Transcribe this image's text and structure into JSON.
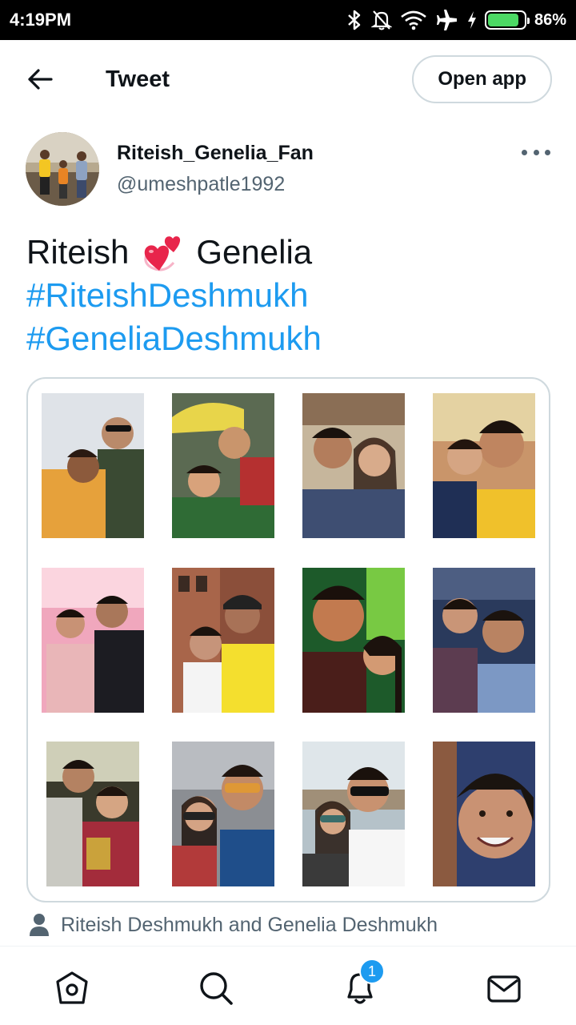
{
  "status_bar": {
    "time": "4:19PM",
    "battery_percent": "86%",
    "battery_level": 0.86,
    "icons": [
      "bluetooth-icon",
      "mute-notifications-icon",
      "wifi-icon",
      "airplane-mode-icon",
      "charging-icon",
      "battery-icon"
    ]
  },
  "header": {
    "title": "Tweet",
    "back_icon": "arrow-left-icon",
    "open_app_label": "Open app"
  },
  "tweet": {
    "author_name": "Riteish_Genelia_Fan",
    "author_handle": "@umeshpatle1992",
    "text_before_emoji": "Riteish",
    "emoji": "revolving-hearts-emoji",
    "text_after_emoji": "Genelia",
    "hashtags": [
      "#RiteishDeshmukh",
      "#GeneliaDeshmukh"
    ],
    "more_icon": "more-options-icon"
  },
  "media": {
    "photos": [
      {
        "alt": "collage-photo-1"
      },
      {
        "alt": "collage-photo-2"
      },
      {
        "alt": "collage-photo-3"
      },
      {
        "alt": "collage-photo-4"
      },
      {
        "alt": "collage-photo-5"
      },
      {
        "alt": "collage-photo-6"
      },
      {
        "alt": "collage-photo-7"
      },
      {
        "alt": "collage-photo-8"
      },
      {
        "alt": "collage-photo-9"
      },
      {
        "alt": "collage-photo-10"
      },
      {
        "alt": "collage-photo-11"
      },
      {
        "alt": "collage-photo-12"
      }
    ]
  },
  "tagged": {
    "icon": "person-icon",
    "label": "Riteish Deshmukh and Genelia Deshmukh"
  },
  "bottom_nav": {
    "items": [
      "home-icon",
      "search-icon",
      "notifications-icon",
      "messages-icon"
    ],
    "notification_count": "1"
  },
  "colors": {
    "link": "#1d9bf0",
    "secondary_text": "#536471",
    "border": "#cfd9de",
    "battery_fill": "#4cd964"
  }
}
